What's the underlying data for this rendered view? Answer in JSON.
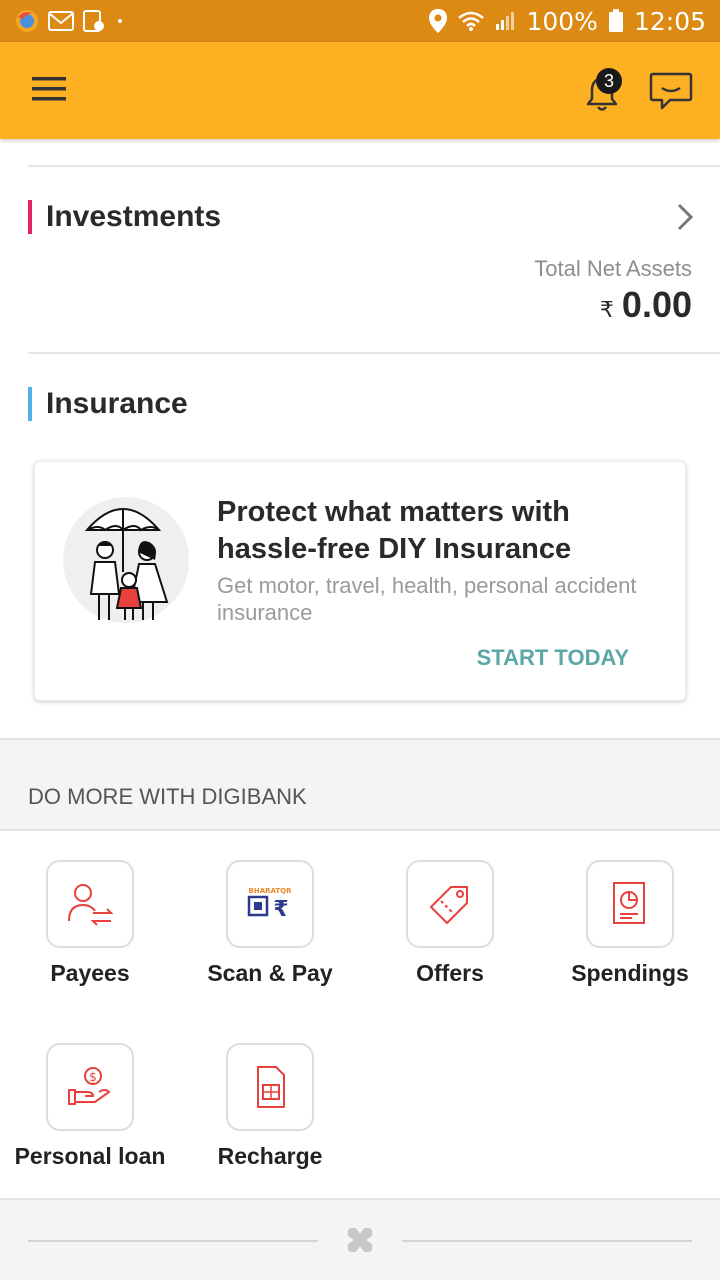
{
  "status_bar": {
    "battery": "100%",
    "time": "12:05",
    "icons": [
      "firefox-icon",
      "gmail-icon",
      "screenshot-icon",
      "dot-icon",
      "location-icon",
      "wifi-icon",
      "signal-icon",
      "battery-icon"
    ]
  },
  "app_bar": {
    "notification_count": "3",
    "icons": [
      "menu-icon",
      "bell-icon",
      "chat-icon"
    ],
    "color": "#fdb022"
  },
  "investments": {
    "title": "Investments",
    "accent": "#e0245e",
    "total_label": "Total Net Assets",
    "currency": "₹",
    "total_value": "0.00"
  },
  "insurance": {
    "title": "Insurance",
    "accent": "#4fb3e8",
    "card": {
      "headline": "Protect what matters with hassle-free DIY Insurance",
      "subtext": "Get motor, travel, health, personal accident insurance",
      "cta": "START TODAY",
      "cta_color": "#5ea7a8"
    }
  },
  "do_more": {
    "label": "DO MORE WITH DIGIBANK",
    "tiles": [
      {
        "label": "Payees",
        "icon": "payees-icon"
      },
      {
        "label": "Scan & Pay",
        "icon": "bharat-qr-icon",
        "brand_text": "BHARATQR"
      },
      {
        "label": "Offers",
        "icon": "offers-tag-icon"
      },
      {
        "label": "Spendings",
        "icon": "spendings-report-icon"
      },
      {
        "label": "Personal loan",
        "icon": "personal-loan-icon"
      },
      {
        "label": "Recharge",
        "icon": "sim-card-icon"
      }
    ]
  },
  "footer": {
    "icon": "digibank-logo-icon"
  }
}
